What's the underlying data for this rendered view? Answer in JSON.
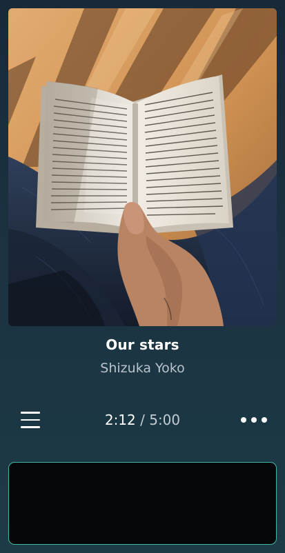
{
  "track": {
    "title": "Our stars",
    "artist": "Shizuka Yoko"
  },
  "player": {
    "elapsed": "2:12",
    "separator": " / ",
    "duration": "5:00"
  },
  "icons": {
    "menu": "hamburger-menu-icon",
    "more": "more-horizontal-icon"
  },
  "colors": {
    "background_top": "#18293a",
    "background_bottom": "#1d3a47",
    "panel": "#060708",
    "panel_border": "#3fbba3",
    "artist_text": "#b9c3cb"
  }
}
